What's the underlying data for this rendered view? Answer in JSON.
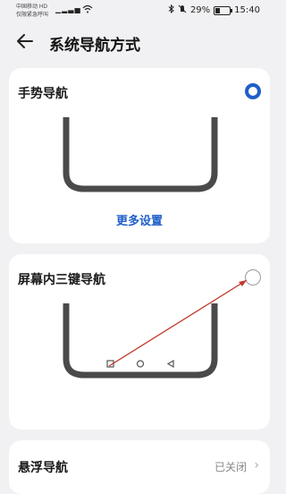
{
  "status_bar": {
    "carrier_line1": "中国移动 HD",
    "carrier_line2": "仅限紧急呼叫",
    "battery": "29%",
    "battery_level": 0.29,
    "time": "15:40"
  },
  "header": {
    "title": "系统导航方式"
  },
  "options": [
    {
      "label": "手势导航",
      "selected": true,
      "more_settings": "更多设置"
    },
    {
      "label": "屏幕内三键导航",
      "selected": false
    }
  ],
  "floating_nav": {
    "label": "悬浮导航",
    "value": "已关闭"
  },
  "colors": {
    "accent": "#1e5fc8",
    "annotation": "#c0392b"
  }
}
